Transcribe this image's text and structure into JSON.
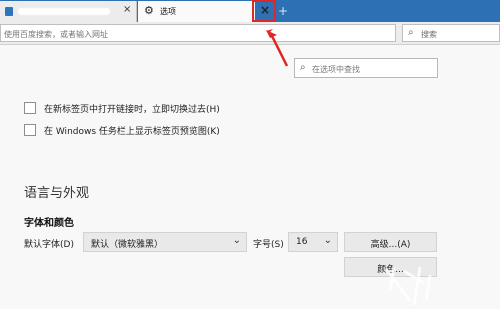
{
  "tabs": [
    {
      "title": "",
      "close": "×"
    },
    {
      "title": "选项",
      "close": "×"
    }
  ],
  "icons": {
    "gear": "gear-icon",
    "close": "close-icon",
    "search": "search-icon",
    "new_tab": "plus-icon",
    "dropdown": "chevron-down-icon"
  },
  "address_bar": {
    "placeholder": "使用百度搜索，或者输入网址"
  },
  "search_bar": {
    "placeholder": "搜索"
  },
  "options_search": {
    "placeholder": "在选项中查找"
  },
  "checkboxes": [
    {
      "label": "在新标签页中打开链接时，立即切换过去(H)",
      "checked": false
    },
    {
      "label": "在 Windows 任务栏上显示标签页预览图(K)",
      "checked": false
    }
  ],
  "language_section": {
    "title": "语言与外观",
    "fonts_title": "字体和颜色",
    "default_font_label": "默认字体(D)",
    "default_font_value": "默认（微软雅黑）",
    "font_size_label": "字号(S)",
    "font_size_value": "16",
    "advanced_button": "高级...(A)",
    "colors_button": "颜色..."
  },
  "colors": {
    "tabbar": "#2d71b4",
    "highlight": "#e02626"
  }
}
